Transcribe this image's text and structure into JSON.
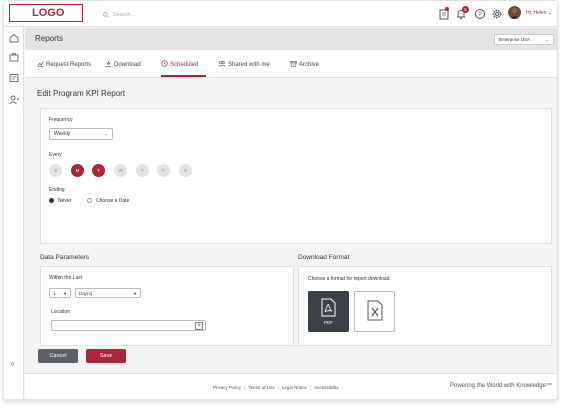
{
  "header": {
    "logo": "LOGO",
    "search_placeholder": "Search...",
    "notification_count": "5",
    "user_greeting": "Hi, Helen"
  },
  "reports_header": {
    "title": "Reports",
    "enterprise": "Enterprise USA"
  },
  "tabs": [
    {
      "label": "Request Reports"
    },
    {
      "label": "Download"
    },
    {
      "label": "Scheduled"
    },
    {
      "label": "Shared with me"
    },
    {
      "label": "Archive"
    }
  ],
  "page_title": "Edit Program KPI Report",
  "schedule": {
    "frequency_label": "Frequency",
    "frequency_value": "Weekly",
    "every_label": "Every",
    "days": [
      {
        "label": "S",
        "selected": false
      },
      {
        "label": "M",
        "selected": true
      },
      {
        "label": "T",
        "selected": true
      },
      {
        "label": "W",
        "selected": false
      },
      {
        "label": "T",
        "selected": false
      },
      {
        "label": "F",
        "selected": false
      },
      {
        "label": "S",
        "selected": false
      }
    ],
    "ending_label": "Ending",
    "ending_options": [
      "Never",
      "Choose a Date"
    ],
    "ending_selected": "Never"
  },
  "data_parameters": {
    "title": "Data Parameters",
    "within_label": "Within the Last",
    "count_value": "1",
    "unit_value": "Day(s)",
    "location_label": "Location",
    "location_value": ""
  },
  "download_format": {
    "title": "Download Format",
    "instructions": "Choose a format for report download.",
    "formats": [
      "PDF",
      "XLS"
    ],
    "selected": "PDF"
  },
  "actions": {
    "cancel": "Cancel",
    "save": "Save"
  },
  "footer": {
    "links": [
      "Privacy Policy",
      "Terms of Use",
      "Legal Notice",
      "Accessibility"
    ],
    "tagline": "Powering the World with Knowledge™"
  },
  "colors": {
    "brand": "#a8283a",
    "dark_button": "#5b6068"
  }
}
